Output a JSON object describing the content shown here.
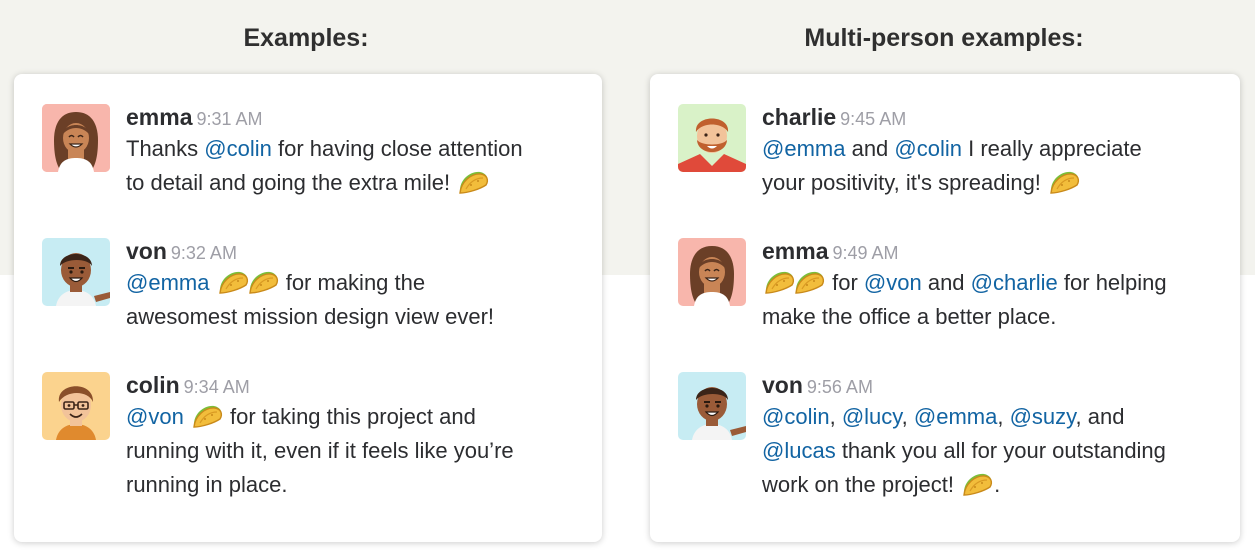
{
  "left_heading": "Examples:",
  "right_heading": "Multi-person examples:",
  "left": [
    {
      "name": "emma",
      "time": "9:31 AM",
      "p": [
        "Thanks ",
        "@colin",
        " for having close attention",
        "to detail and going the extra mile! "
      ]
    },
    {
      "name": "von",
      "time": "9:32 AM",
      "p": [
        "@emma",
        " for making the",
        "awesomest mission design view ever!"
      ]
    },
    {
      "name": "colin",
      "time": "9:34 AM",
      "p": [
        "@von",
        " for taking this project and",
        "running with it, even if it feels like you’re",
        "running in place."
      ]
    }
  ],
  "right": [
    {
      "name": "charlie",
      "time": "9:45 AM",
      "p": [
        "@emma",
        " and ",
        "@colin",
        " I really appreciate",
        "your positivity, it's spreading! "
      ]
    },
    {
      "name": "emma",
      "time": "9:49 AM",
      "p": [
        " for ",
        "@von",
        " and ",
        "@charlie",
        " for helping",
        "make the office a better place."
      ]
    },
    {
      "name": "von",
      "time": "9:56 AM",
      "p": [
        "@colin",
        ", ",
        "@lucy",
        ", ",
        "@emma",
        ", ",
        "@suzy",
        ", and",
        "@lucas",
        " thank you all for your outstanding",
        "work on the project! ",
        "."
      ]
    }
  ],
  "icons": {
    "taco": "taco-icon",
    "avatars": [
      "emma-avatar",
      "von-avatar",
      "colin-avatar",
      "charlie-avatar"
    ]
  },
  "colors": {
    "mention": "#1264a3",
    "timestamp": "#9e9ea6",
    "band": "#f3f3ee",
    "emma_bg": "#f8b6ac",
    "von_bg": "#c7ecf3",
    "colin_bg": "#fbd38e",
    "charlie_bg": "#d9f2c8"
  }
}
